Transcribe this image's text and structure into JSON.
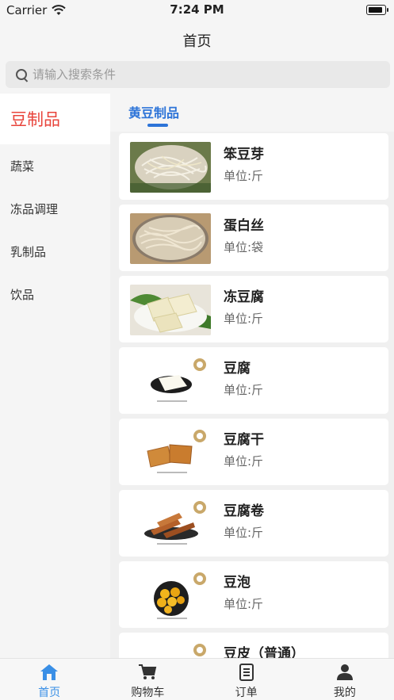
{
  "status": {
    "carrier": "Carrier",
    "time": "7:24 PM",
    "battery_level": 0.9
  },
  "nav": {
    "title": "首页"
  },
  "search": {
    "placeholder": "请输入搜索条件"
  },
  "sidebar": {
    "items": [
      {
        "label": "豆制品",
        "active": true
      },
      {
        "label": "蔬菜"
      },
      {
        "label": "冻品调理"
      },
      {
        "label": "乳制品"
      },
      {
        "label": "饮品"
      }
    ]
  },
  "category": {
    "tab_label": "黄豆制品"
  },
  "products": [
    {
      "name": "笨豆芽",
      "unit": "单位:斤",
      "image": "bean-sprouts-photo"
    },
    {
      "name": "蛋白丝",
      "unit": "单位:袋",
      "image": "tofu-shreds-photo"
    },
    {
      "name": "冻豆腐",
      "unit": "单位:斤",
      "image": "frozen-tofu-photo"
    },
    {
      "name": "豆腐",
      "unit": "单位:斤",
      "image": "tofu-photo"
    },
    {
      "name": "豆腐干",
      "unit": "单位:斤",
      "image": "dried-tofu-photo"
    },
    {
      "name": "豆腐卷",
      "unit": "单位:斤",
      "image": "tofu-roll-photo"
    },
    {
      "name": "豆泡",
      "unit": "单位:斤",
      "image": "tofu-puff-photo"
    },
    {
      "name": "豆皮（普通）",
      "unit": "",
      "image": "tofu-skin-photo"
    }
  ],
  "tabbar": {
    "items": [
      {
        "label": "首页",
        "icon": "home-icon",
        "active": true
      },
      {
        "label": "购物车",
        "icon": "cart-icon"
      },
      {
        "label": "订单",
        "icon": "order-icon"
      },
      {
        "label": "我的",
        "icon": "user-icon"
      }
    ]
  },
  "colors": {
    "accent": "#2d74d8",
    "sidebar_active": "#e8443b",
    "tab_active": "#3a8fe6"
  }
}
